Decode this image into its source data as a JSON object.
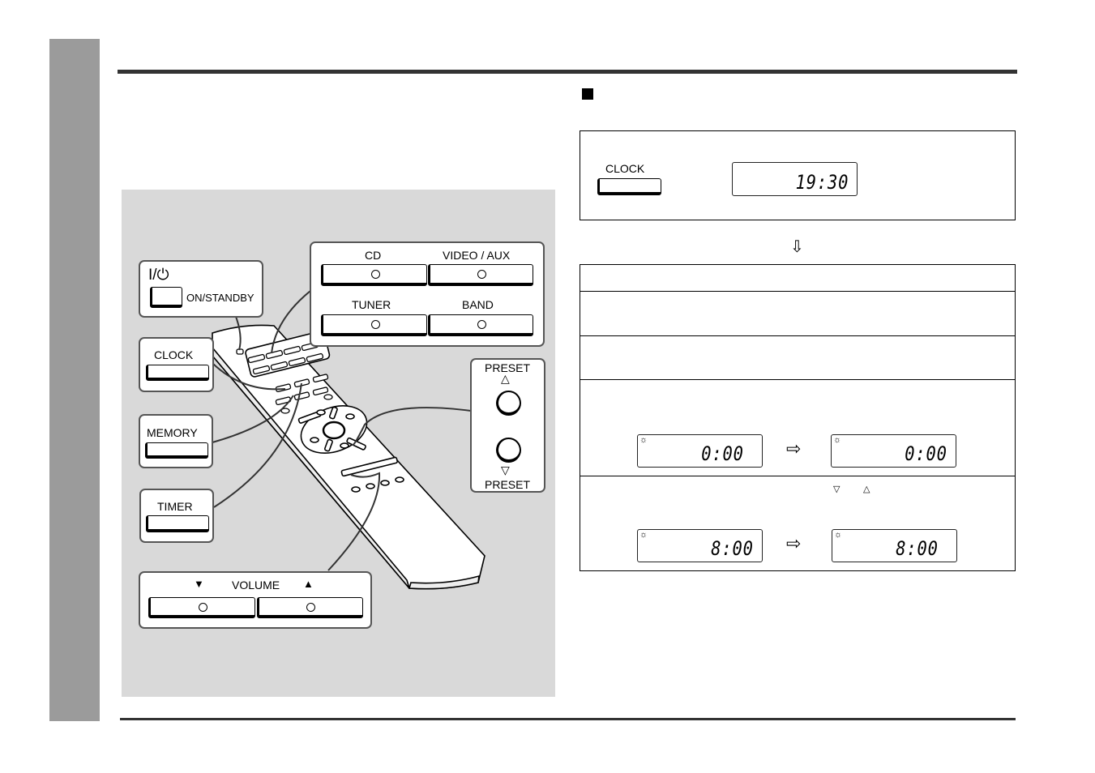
{
  "page": {
    "side_tab_color": "#9b9b9b",
    "rule_color": "#333333"
  },
  "illustration": {
    "background": "#d9d9d9",
    "power": {
      "symbol": "I/⏻",
      "label": "ON/STANDBY"
    },
    "source_buttons": [
      {
        "label": "CD"
      },
      {
        "label": "VIDEO / AUX"
      },
      {
        "label": "TUNER"
      },
      {
        "label": "BAND"
      }
    ],
    "clock": {
      "label": "CLOCK"
    },
    "memory": {
      "label": "MEMORY"
    },
    "timer": {
      "label": "TIMER"
    },
    "preset": {
      "up_label": "PRESET",
      "down_label": "PRESET",
      "up_icon": "△",
      "down_icon": "▽"
    },
    "volume": {
      "label": "VOLUME",
      "down_icon": "▼",
      "up_icon": "▲"
    }
  },
  "procedure": {
    "bullet": "■",
    "first_box": {
      "button_label": "CLOCK",
      "display": "19:30"
    },
    "arrow": "⇩",
    "steps": [
      {
        "text": ""
      },
      {
        "text": ""
      },
      {
        "text": ""
      },
      {
        "text": "",
        "display_before": "0:00",
        "display_after": "0:00",
        "arrow": "⇨"
      },
      {
        "text": "",
        "tri_down": "▽",
        "tri_up": "△",
        "display_before": "8:00",
        "display_after": "8:00",
        "arrow": "⇨"
      }
    ]
  }
}
